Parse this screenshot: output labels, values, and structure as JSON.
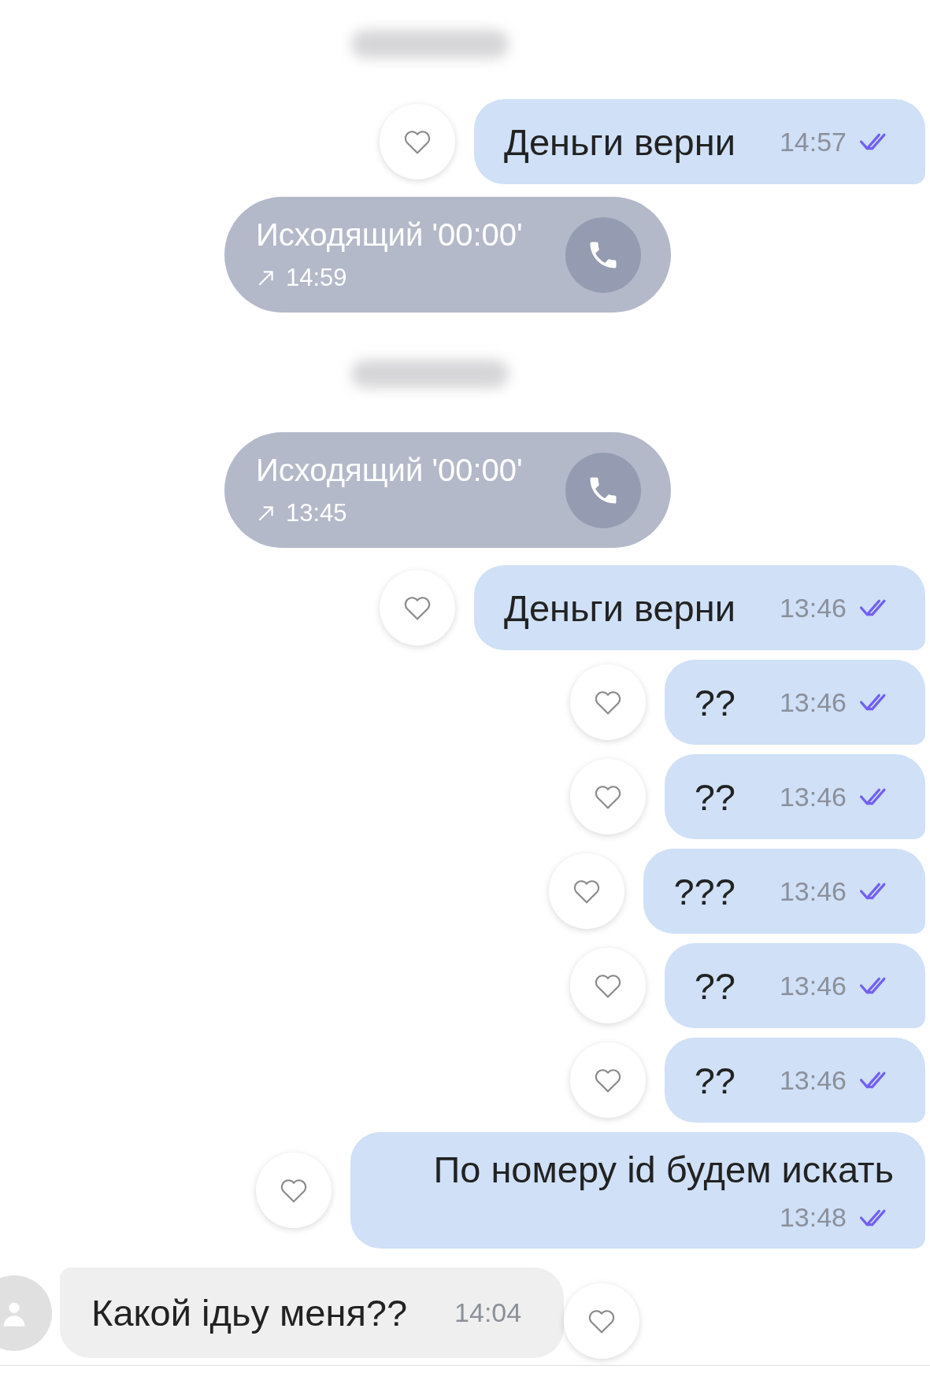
{
  "messages": [
    {
      "kind": "date_hidden"
    },
    {
      "kind": "outgoing",
      "text": "Деньги верни",
      "time": "14:57",
      "read": true,
      "liked": false
    },
    {
      "kind": "call",
      "text": "Исходящий '00:00'",
      "time": "14:59"
    },
    {
      "kind": "date_hidden"
    },
    {
      "kind": "call",
      "text": "Исходящий '00:00'",
      "time": "13:45"
    },
    {
      "kind": "outgoing",
      "text": "Деньги верни",
      "time": "13:46",
      "read": true,
      "liked": false
    },
    {
      "kind": "outgoing",
      "text": "??",
      "time": "13:46",
      "read": true,
      "liked": false
    },
    {
      "kind": "outgoing",
      "text": "??",
      "time": "13:46",
      "read": true,
      "liked": false
    },
    {
      "kind": "outgoing",
      "text": "???",
      "time": "13:46",
      "read": true,
      "liked": false
    },
    {
      "kind": "outgoing",
      "text": "??",
      "time": "13:46",
      "read": true,
      "liked": false
    },
    {
      "kind": "outgoing",
      "text": "??",
      "time": "13:46",
      "read": true,
      "liked": false
    },
    {
      "kind": "outgoing",
      "text": "По номеру id будем искать",
      "time": "13:48",
      "read": true,
      "liked": false
    },
    {
      "kind": "incoming",
      "text": "Какой ідьу меня??",
      "time": "14:04",
      "liked": false
    }
  ]
}
